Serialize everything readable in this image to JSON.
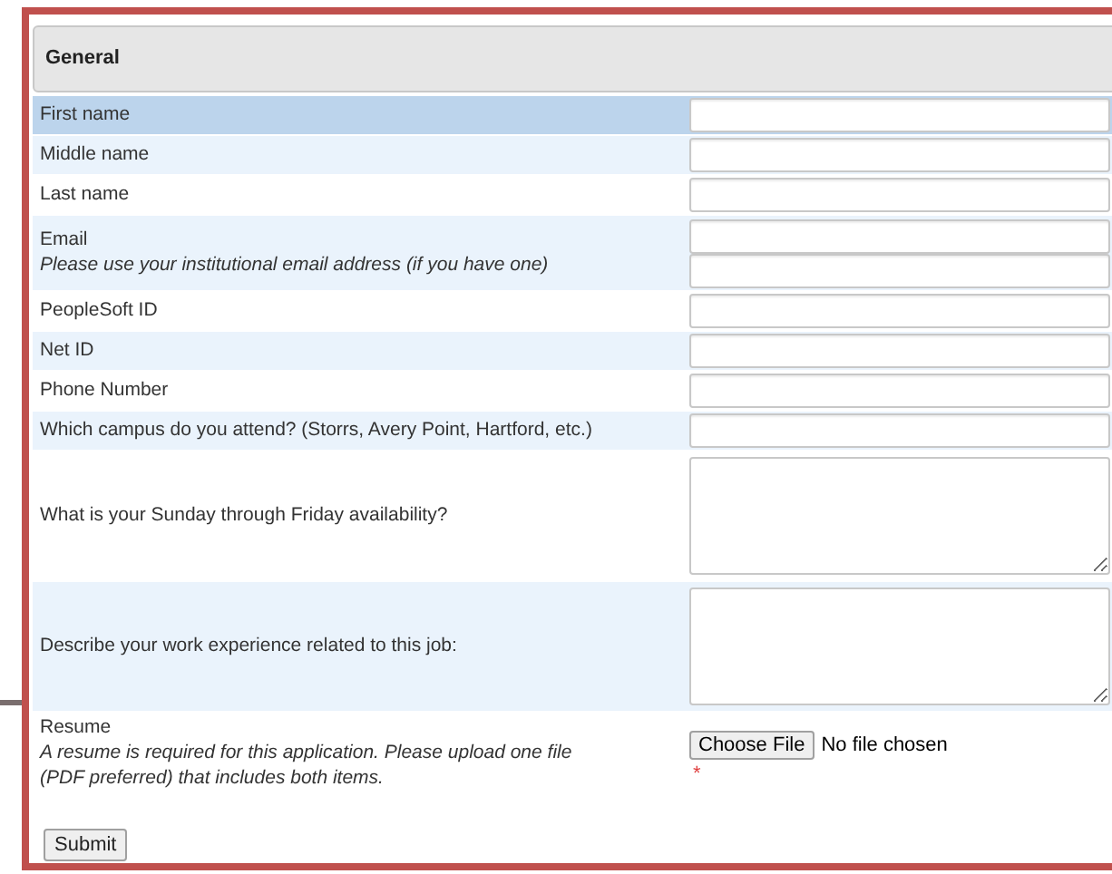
{
  "section": {
    "title": "General"
  },
  "rows": [
    {
      "kind": "text",
      "label": "First name",
      "selected": true
    },
    {
      "kind": "text",
      "label": "Middle name",
      "selected": false
    },
    {
      "kind": "text",
      "label": "Last name",
      "selected": false
    },
    {
      "kind": "double",
      "label": "Email",
      "hint": "Please use your institutional email address (if you have one)",
      "selected": false
    },
    {
      "kind": "text",
      "label": "PeopleSoft ID",
      "selected": false
    },
    {
      "kind": "text",
      "label": "Net ID",
      "selected": false
    },
    {
      "kind": "text",
      "label": "Phone Number",
      "selected": false
    },
    {
      "kind": "text",
      "label": "Which campus do you attend? (Storrs, Avery Point, Hartford, etc.)",
      "selected": false
    },
    {
      "kind": "textarea",
      "label": "What is your Sunday through Friday availability?",
      "selected": false
    },
    {
      "kind": "textarea",
      "label": "Describe your work experience related to this job:",
      "selected": false
    },
    {
      "kind": "file",
      "label": "Resume",
      "hint": "A resume is required for this application. Please upload one file (PDF preferred) that includes both items.",
      "button": "Choose File",
      "status": "No file chosen",
      "required": "*",
      "selected": false
    }
  ],
  "submit": "Submit"
}
